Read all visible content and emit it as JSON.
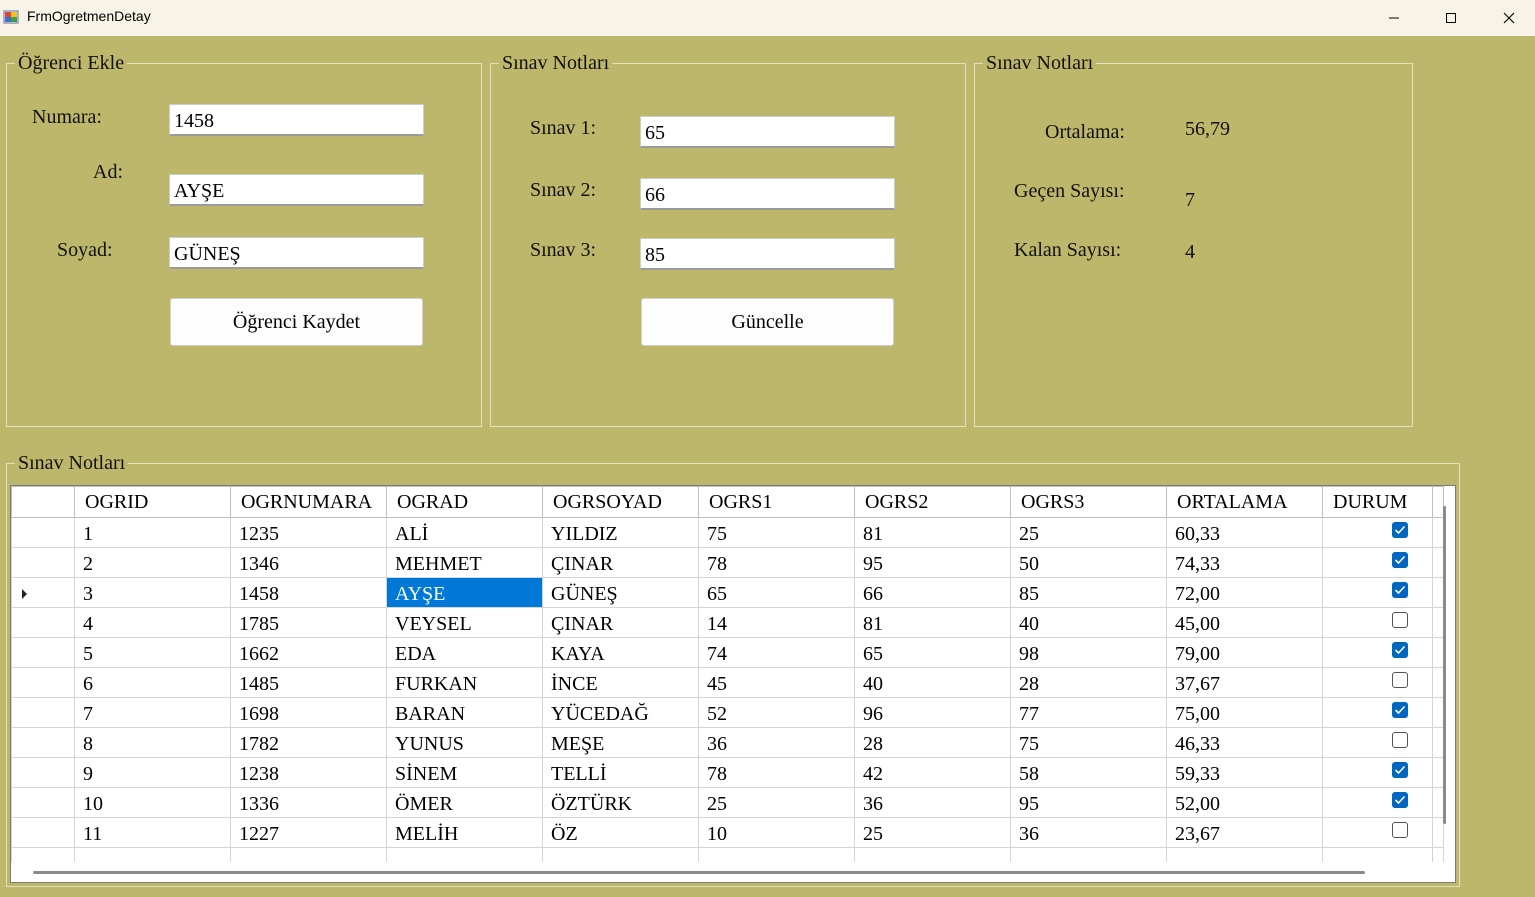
{
  "window": {
    "title": "FrmOgretmenDetay"
  },
  "student_add": {
    "legend": "Öğrenci Ekle",
    "numara_label": "Numara:",
    "numara_value": "1458",
    "ad_label": "Ad:",
    "ad_value": "AYŞE",
    "soyad_label": "Soyad:",
    "soyad_value": "GÜNEŞ",
    "save_button": "Öğrenci Kaydet"
  },
  "exam_grades": {
    "legend": "Sınav Notları",
    "sinav1_label": "Sınav 1:",
    "sinav1_value": "65",
    "sinav2_label": "Sınav 2:",
    "sinav2_value": "66",
    "sinav3_label": "Sınav 3:",
    "sinav3_value": "85",
    "update_button": "Güncelle"
  },
  "stats": {
    "legend": "Sınav Notları",
    "ortalama_label": "Ortalama:",
    "ortalama_value": "56,79",
    "gecen_label": "Geçen Sayısı:",
    "gecen_value": "7",
    "kalan_label": "Kalan Sayısı:",
    "kalan_value": "4"
  },
  "grid": {
    "legend": "Sınav Notları",
    "columns": [
      "OGRID",
      "OGRNUMARA",
      "OGRAD",
      "OGRSOYAD",
      "OGRS1",
      "OGRS2",
      "OGRS3",
      "ORTALAMA",
      "DURUM"
    ],
    "selected_row": 2,
    "rows": [
      [
        "1",
        "1235",
        "ALİ",
        "YILDIZ",
        "75",
        "81",
        "25",
        "60,33",
        true
      ],
      [
        "2",
        "1346",
        "MEHMET",
        "ÇINAR",
        "78",
        "95",
        "50",
        "74,33",
        true
      ],
      [
        "3",
        "1458",
        "AYŞE",
        "GÜNEŞ",
        "65",
        "66",
        "85",
        "72,00",
        true
      ],
      [
        "4",
        "1785",
        "VEYSEL",
        "ÇINAR",
        "14",
        "81",
        "40",
        "45,00",
        false
      ],
      [
        "5",
        "1662",
        "EDA",
        "KAYA",
        "74",
        "65",
        "98",
        "79,00",
        true
      ],
      [
        "6",
        "1485",
        "FURKAN",
        "İNCE",
        "45",
        "40",
        "28",
        "37,67",
        false
      ],
      [
        "7",
        "1698",
        "BARAN",
        "YÜCEDAĞ",
        "52",
        "96",
        "77",
        "75,00",
        true
      ],
      [
        "8",
        "1782",
        "YUNUS",
        "MEŞE",
        "36",
        "28",
        "75",
        "46,33",
        false
      ],
      [
        "9",
        "1238",
        "SİNEM",
        "TELLİ",
        "78",
        "42",
        "58",
        "59,33",
        true
      ],
      [
        "10",
        "1336",
        "ÖMER",
        "ÖZTÜRK",
        "25",
        "36",
        "95",
        "52,00",
        true
      ],
      [
        "11",
        "1227",
        "MELİH",
        "ÖZ",
        "10",
        "25",
        "36",
        "23,67",
        false
      ]
    ]
  }
}
